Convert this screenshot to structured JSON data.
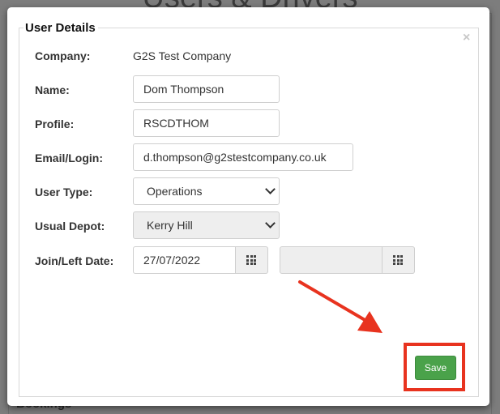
{
  "background": {
    "title": "Users & Drivers",
    "section_label": "Bookings"
  },
  "dialog": {
    "legend": "User Details",
    "close_symbol": "×",
    "fields": {
      "company": {
        "label": "Company:",
        "value": "G2S Test Company"
      },
      "name": {
        "label": "Name:",
        "value": "Dom Thompson"
      },
      "profile": {
        "label": "Profile:",
        "value": "RSCDTHOM"
      },
      "email": {
        "label": "Email/Login:",
        "value": "d.thompson@g2stestcompany.co.uk"
      },
      "user_type": {
        "label": "User Type:",
        "selected": "Operations"
      },
      "usual_depot": {
        "label": "Usual Depot:",
        "selected": "Kerry Hill",
        "disabled": true
      },
      "join_left_date": {
        "label": "Join/Left Date:",
        "join_value": "27/07/2022",
        "left_value": ""
      }
    },
    "save_label": "Save"
  },
  "colors": {
    "annotation": "#e8331f",
    "save_button": "#4aa24a"
  },
  "icons": {
    "close": "close-icon",
    "calendar": "calendar-grid-icon",
    "dropdown": "chevron-down-icon"
  }
}
